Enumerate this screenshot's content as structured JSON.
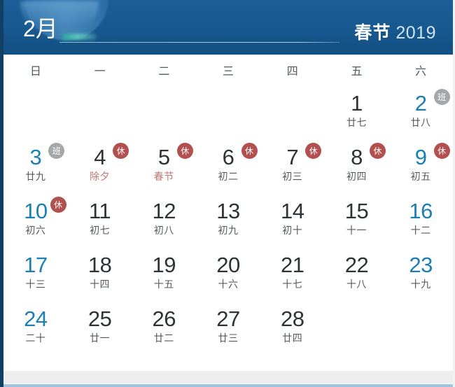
{
  "header": {
    "month": "2月",
    "festival": "春节",
    "year": "2019"
  },
  "weekdays": [
    "日",
    "一",
    "二",
    "三",
    "四",
    "五",
    "六"
  ],
  "badges": {
    "rest_label": "休",
    "work_label": "班"
  },
  "colors": {
    "header_bg": "#17588f",
    "weekend_blue": "#1b7fb5",
    "weekday_dark": "#2e3338",
    "festival_red": "#c4756f",
    "badge_rest": "#b2504f",
    "badge_work": "#a4a8ab",
    "left_border": "#123f66",
    "footer_line": "#9fc4e0"
  },
  "weeks": [
    [
      {
        "num": "",
        "lunar": "",
        "empty": true
      },
      {
        "num": "",
        "lunar": "",
        "empty": true
      },
      {
        "num": "",
        "lunar": "",
        "empty": true
      },
      {
        "num": "",
        "lunar": "",
        "empty": true
      },
      {
        "num": "",
        "lunar": "",
        "empty": true
      },
      {
        "num": "1",
        "lunar": "廿七",
        "weekend": false,
        "festival": false,
        "badge": ""
      },
      {
        "num": "2",
        "lunar": "廿八",
        "weekend": true,
        "festival": false,
        "badge": "work"
      }
    ],
    [
      {
        "num": "3",
        "lunar": "廿九",
        "weekend": true,
        "festival": false,
        "badge": "work"
      },
      {
        "num": "4",
        "lunar": "除夕",
        "weekend": false,
        "festival": true,
        "badge": "rest"
      },
      {
        "num": "5",
        "lunar": "春节",
        "weekend": false,
        "festival": true,
        "badge": "rest"
      },
      {
        "num": "6",
        "lunar": "初二",
        "weekend": false,
        "festival": false,
        "badge": "rest"
      },
      {
        "num": "7",
        "lunar": "初三",
        "weekend": false,
        "festival": false,
        "badge": "rest"
      },
      {
        "num": "8",
        "lunar": "初四",
        "weekend": false,
        "festival": false,
        "badge": "rest"
      },
      {
        "num": "9",
        "lunar": "初五",
        "weekend": true,
        "festival": false,
        "badge": "rest"
      }
    ],
    [
      {
        "num": "10",
        "lunar": "初六",
        "weekend": true,
        "festival": false,
        "badge": "rest"
      },
      {
        "num": "11",
        "lunar": "初七",
        "weekend": false,
        "festival": false,
        "badge": ""
      },
      {
        "num": "12",
        "lunar": "初八",
        "weekend": false,
        "festival": false,
        "badge": ""
      },
      {
        "num": "13",
        "lunar": "初九",
        "weekend": false,
        "festival": false,
        "badge": ""
      },
      {
        "num": "14",
        "lunar": "初十",
        "weekend": false,
        "festival": false,
        "badge": ""
      },
      {
        "num": "15",
        "lunar": "十一",
        "weekend": false,
        "festival": false,
        "badge": ""
      },
      {
        "num": "16",
        "lunar": "十二",
        "weekend": true,
        "festival": false,
        "badge": ""
      }
    ],
    [
      {
        "num": "17",
        "lunar": "十三",
        "weekend": true,
        "festival": false,
        "badge": ""
      },
      {
        "num": "18",
        "lunar": "十四",
        "weekend": false,
        "festival": false,
        "badge": ""
      },
      {
        "num": "19",
        "lunar": "十五",
        "weekend": false,
        "festival": false,
        "badge": ""
      },
      {
        "num": "20",
        "lunar": "十六",
        "weekend": false,
        "festival": false,
        "badge": ""
      },
      {
        "num": "21",
        "lunar": "十七",
        "weekend": false,
        "festival": false,
        "badge": ""
      },
      {
        "num": "22",
        "lunar": "十八",
        "weekend": false,
        "festival": false,
        "badge": ""
      },
      {
        "num": "23",
        "lunar": "十九",
        "weekend": true,
        "festival": false,
        "badge": ""
      }
    ],
    [
      {
        "num": "24",
        "lunar": "二十",
        "weekend": true,
        "festival": false,
        "badge": ""
      },
      {
        "num": "25",
        "lunar": "廿一",
        "weekend": false,
        "festival": false,
        "badge": ""
      },
      {
        "num": "26",
        "lunar": "廿二",
        "weekend": false,
        "festival": false,
        "badge": ""
      },
      {
        "num": "27",
        "lunar": "廿三",
        "weekend": false,
        "festival": false,
        "badge": ""
      },
      {
        "num": "28",
        "lunar": "廿四",
        "weekend": false,
        "festival": false,
        "badge": ""
      },
      {
        "num": "",
        "lunar": "",
        "empty": true
      },
      {
        "num": "",
        "lunar": "",
        "empty": true
      }
    ]
  ]
}
